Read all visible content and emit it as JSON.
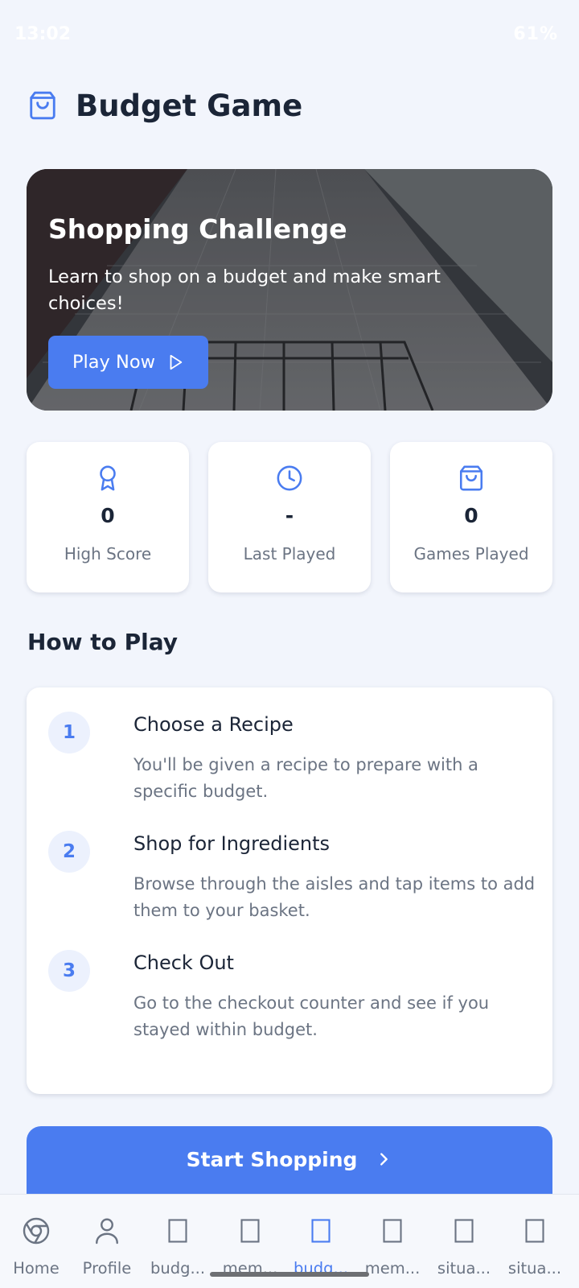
{
  "status_bar": {
    "time": "13:02",
    "indicators": "61%"
  },
  "header": {
    "title": "Budget Game",
    "icon": "shopping-bag-icon"
  },
  "hero": {
    "title": "Shopping Challenge",
    "description": "Learn to shop on a budget and make smart choices!",
    "play_label": "Play Now",
    "background": "supermarket-aisle-photo"
  },
  "stats": [
    {
      "icon": "award-icon",
      "value": "0",
      "label": "High Score"
    },
    {
      "icon": "clock-icon",
      "value": "-",
      "label": "Last Played"
    },
    {
      "icon": "shopping-bag-icon",
      "value": "0",
      "label": "Games Played"
    }
  ],
  "how_to_play": {
    "title": "How to Play",
    "steps": [
      {
        "number": "1",
        "title": "Choose a Recipe",
        "description": "You'll be given a recipe to prepare with a specific budget."
      },
      {
        "number": "2",
        "title": "Shop for Ingredients",
        "description": "Browse through the aisles and tap items to add them to your basket."
      },
      {
        "number": "3",
        "title": "Check Out",
        "description": "Go to the checkout counter and see if you stayed within budget."
      }
    ]
  },
  "start_button": {
    "label": "Start Shopping"
  },
  "bottom_nav": [
    {
      "label": "Home",
      "icon": "chrome-icon",
      "active": false
    },
    {
      "label": "Profile",
      "icon": "user-icon",
      "active": false
    },
    {
      "label": "budg...",
      "icon": "placeholder-icon",
      "active": false
    },
    {
      "label": "mem...",
      "icon": "placeholder-icon",
      "active": false
    },
    {
      "label": "budg...",
      "icon": "placeholder-icon",
      "active": true
    },
    {
      "label": "mem...",
      "icon": "placeholder-icon",
      "active": false
    },
    {
      "label": "situa...",
      "icon": "placeholder-icon",
      "active": false
    },
    {
      "label": "situa...",
      "icon": "placeholder-icon",
      "active": false
    }
  ],
  "colors": {
    "accent": "#4a7cf0",
    "background": "#f2f5fc",
    "text_primary": "#1b2537",
    "text_secondary": "#6b7483"
  }
}
